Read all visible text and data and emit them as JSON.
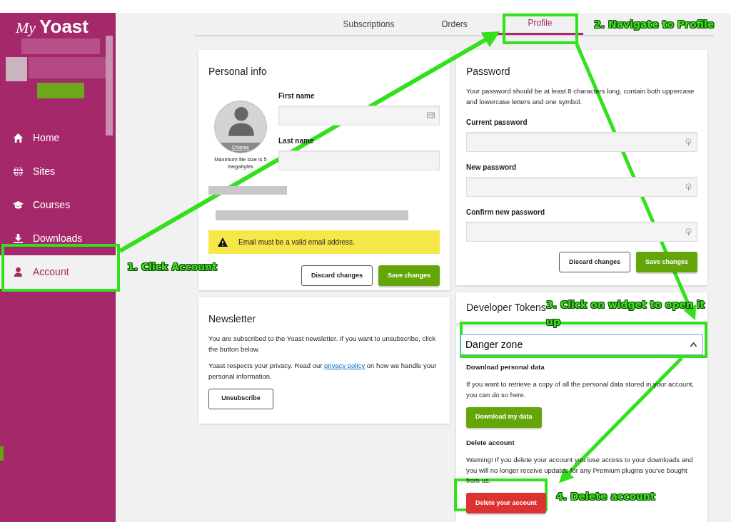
{
  "logo": {
    "prefix": "My",
    "name": "Yoast"
  },
  "sidebar": {
    "items": [
      {
        "label": "Home",
        "selected": false
      },
      {
        "label": "Sites",
        "selected": false
      },
      {
        "label": "Courses",
        "selected": false
      },
      {
        "label": "Downloads",
        "selected": false
      },
      {
        "label": "Account",
        "selected": true
      }
    ]
  },
  "tabs": [
    {
      "label": "Subscriptions",
      "selected": false
    },
    {
      "label": "Orders",
      "selected": false
    },
    {
      "label": "Profile",
      "selected": true
    }
  ],
  "personal_info": {
    "title": "Personal info",
    "avatar": {
      "link": "Change",
      "note": "Maximum file size is 5 megabytes"
    },
    "fields": [
      {
        "label": "First name"
      },
      {
        "label": "Last name"
      }
    ],
    "alert": {
      "kind": "warning",
      "text": "Email must be a valid email address."
    },
    "buttons": [
      {
        "label": "Discard changes",
        "kind": "secondary"
      },
      {
        "label": "Save changes",
        "kind": "primary"
      }
    ]
  },
  "newsletter": {
    "title": "Newsletter",
    "text": "You are subscribed to the Yoast newsletter. If you want to unsubscribe, click the button below.",
    "privacy": {
      "before": "Yoast respects your privacy. Read our ",
      "link": "privacy policy",
      "after": " on how we handle your personal information."
    },
    "button": {
      "label": "Unsubscribe",
      "kind": "secondary"
    }
  },
  "password": {
    "title": "Password",
    "hint": "Your password should be at least 8 characters long, contain both uppercase and lowercase letters and one symbol.",
    "fields": [
      {
        "label": "Current password"
      },
      {
        "label": "New password"
      },
      {
        "label": "Confirm new password"
      }
    ],
    "buttons": [
      {
        "label": "Discard changes",
        "kind": "secondary"
      },
      {
        "label": "Save changes",
        "kind": "primary"
      }
    ]
  },
  "developer_tokens": {
    "title": "Developer Tokens"
  },
  "danger_zone": {
    "title": "Danger zone",
    "expanded": true,
    "sections": [
      {
        "heading": "Download personal data",
        "text": "If you want to retrieve a copy of all the personal data stored in your account, you can do so here.",
        "button": {
          "label": "Download my data",
          "kind": "primary"
        }
      },
      {
        "heading": "Delete account",
        "text": "Warning! If you delete your account you lose access to your downloads and you will no longer receive updates for any Premium plugins you've bought from us.",
        "button": {
          "label": "Delete your account",
          "kind": "danger"
        }
      }
    ]
  },
  "annotations": [
    {
      "text": "1. Click Account"
    },
    {
      "text": "2. Navigate to Profile"
    },
    {
      "text": "3. Click on widget to open it up"
    },
    {
      "text": "4. Delete account"
    }
  ]
}
